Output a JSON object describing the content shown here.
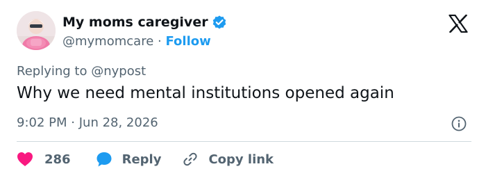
{
  "author": {
    "display_name": "My moms caregiver",
    "handle": "@mymomcare",
    "separator": "·",
    "follow_label": "Follow"
  },
  "tweet": {
    "replying_prefix": "Replying to",
    "replying_to": "@nypost",
    "text": "Why we need mental institutions opened again",
    "time": "9:02 PM",
    "meta_separator": "·",
    "date": "Jun 28, 2026"
  },
  "actions": {
    "like_count": "286",
    "reply_label": "Reply",
    "copy_link_label": "Copy link"
  },
  "colors": {
    "accent": "#1d9bf0",
    "like": "#f91880",
    "text": "#0f1419",
    "muted": "#536471",
    "divider": "#cfd9de"
  },
  "icons": [
    "verified-badge-icon",
    "x-logo-icon",
    "info-icon",
    "heart-icon",
    "reply-bubble-icon",
    "link-icon"
  ]
}
